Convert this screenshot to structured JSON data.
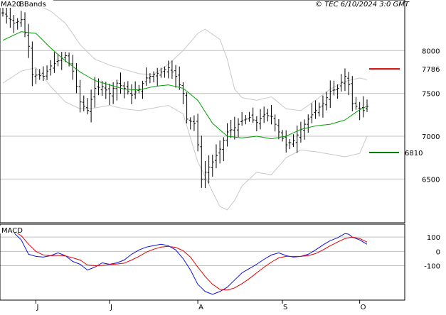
{
  "header": {
    "ma_legend": "MA20",
    "bb_legend": "BBands",
    "copyright": "© TEC 6/10/2024 3:0 GMT"
  },
  "colors": {
    "bars": "#000000",
    "ma": "#00a000",
    "bbands": "#c8c8c8",
    "macd": "#1010e0",
    "signal": "#e00000",
    "resistance": "#d00000",
    "support": "#008000",
    "grid": "#c0c0c0"
  },
  "chart_data": [
    {
      "type": "ohlc",
      "y_ticks": [
        {
          "value": 8000,
          "label": "8000"
        },
        {
          "value": 7500,
          "label": "7500"
        },
        {
          "value": 7000,
          "label": "7000"
        },
        {
          "value": 6500,
          "label": "6500"
        }
      ],
      "ylim": [
        5990,
        8590
      ],
      "x_ticks": [
        {
          "index": 9,
          "label": "J"
        },
        {
          "index": 29,
          "label": "J"
        },
        {
          "index": 53,
          "label": "A"
        },
        {
          "index": 76,
          "label": "S"
        },
        {
          "index": 97,
          "label": "O"
        }
      ],
      "n_points": 100,
      "levels": [
        {
          "name": "resistance",
          "value": 7786,
          "label": "7786"
        },
        {
          "name": "support",
          "value": 6810,
          "label": "6810"
        }
      ],
      "close_anchors": [
        [
          0,
          8440
        ],
        [
          3,
          8320
        ],
        [
          5,
          8360
        ],
        [
          7,
          8050
        ],
        [
          8,
          7720
        ],
        [
          11,
          7700
        ],
        [
          13,
          7820
        ],
        [
          15,
          7880
        ],
        [
          17,
          7940
        ],
        [
          19,
          7760
        ],
        [
          21,
          7400
        ],
        [
          23,
          7300
        ],
        [
          25,
          7560
        ],
        [
          27,
          7580
        ],
        [
          29,
          7500
        ],
        [
          31,
          7620
        ],
        [
          33,
          7560
        ],
        [
          35,
          7480
        ],
        [
          37,
          7550
        ],
        [
          39,
          7680
        ],
        [
          41,
          7720
        ],
        [
          43,
          7750
        ],
        [
          45,
          7800
        ],
        [
          47,
          7700
        ],
        [
          49,
          7500
        ],
        [
          50,
          7200
        ],
        [
          52,
          7150
        ],
        [
          53,
          6900
        ],
        [
          54,
          6500
        ],
        [
          55,
          6580
        ],
        [
          57,
          6700
        ],
        [
          59,
          6850
        ],
        [
          61,
          7050
        ],
        [
          63,
          7100
        ],
        [
          65,
          7180
        ],
        [
          67,
          7220
        ],
        [
          69,
          7160
        ],
        [
          71,
          7250
        ],
        [
          73,
          7230
        ],
        [
          75,
          7050
        ],
        [
          77,
          6900
        ],
        [
          79,
          6950
        ],
        [
          81,
          7080
        ],
        [
          83,
          7200
        ],
        [
          85,
          7300
        ],
        [
          87,
          7380
        ],
        [
          89,
          7520
        ],
        [
          91,
          7560
        ],
        [
          93,
          7700
        ],
        [
          94,
          7600
        ],
        [
          95,
          7380
        ],
        [
          97,
          7320
        ],
        [
          98,
          7300
        ],
        [
          99,
          7350
        ]
      ],
      "ma20_anchors": [
        [
          0,
          8120
        ],
        [
          5,
          8220
        ],
        [
          9,
          8200
        ],
        [
          13,
          8030
        ],
        [
          17,
          7880
        ],
        [
          21,
          7750
        ],
        [
          25,
          7650
        ],
        [
          29,
          7600
        ],
        [
          33,
          7550
        ],
        [
          37,
          7540
        ],
        [
          41,
          7580
        ],
        [
          45,
          7600
        ],
        [
          49,
          7560
        ],
        [
          53,
          7420
        ],
        [
          57,
          7150
        ],
        [
          61,
          7000
        ],
        [
          65,
          6980
        ],
        [
          69,
          7000
        ],
        [
          73,
          6970
        ],
        [
          77,
          7000
        ],
        [
          81,
          7080
        ],
        [
          85,
          7120
        ],
        [
          89,
          7140
        ],
        [
          93,
          7190
        ],
        [
          97,
          7310
        ],
        [
          99,
          7350
        ]
      ],
      "bb_upper_anchors": [
        [
          0,
          8550
        ],
        [
          5,
          8560
        ],
        [
          9,
          8540
        ],
        [
          13,
          8460
        ],
        [
          17,
          8320
        ],
        [
          21,
          8070
        ],
        [
          25,
          7900
        ],
        [
          29,
          7830
        ],
        [
          33,
          7780
        ],
        [
          37,
          7730
        ],
        [
          41,
          7720
        ],
        [
          45,
          7840
        ],
        [
          49,
          8000
        ],
        [
          53,
          8200
        ],
        [
          55,
          8250
        ],
        [
          59,
          8130
        ],
        [
          61,
          7900
        ],
        [
          63,
          7550
        ],
        [
          65,
          7450
        ],
        [
          69,
          7420
        ],
        [
          73,
          7460
        ],
        [
          77,
          7320
        ],
        [
          81,
          7300
        ],
        [
          85,
          7420
        ],
        [
          89,
          7550
        ],
        [
          93,
          7640
        ],
        [
          97,
          7680
        ],
        [
          99,
          7660
        ]
      ],
      "bb_lower_anchors": [
        [
          0,
          7620
        ],
        [
          5,
          7760
        ],
        [
          9,
          7800
        ],
        [
          13,
          7580
        ],
        [
          17,
          7400
        ],
        [
          21,
          7320
        ],
        [
          25,
          7330
        ],
        [
          29,
          7360
        ],
        [
          33,
          7320
        ],
        [
          37,
          7300
        ],
        [
          41,
          7330
        ],
        [
          45,
          7360
        ],
        [
          49,
          7260
        ],
        [
          53,
          6700
        ],
        [
          55,
          6530
        ],
        [
          57,
          6350
        ],
        [
          59,
          6180
        ],
        [
          61,
          6140
        ],
        [
          63,
          6250
        ],
        [
          65,
          6420
        ],
        [
          69,
          6580
        ],
        [
          73,
          6550
        ],
        [
          77,
          6750
        ],
        [
          81,
          6840
        ],
        [
          85,
          6820
        ],
        [
          89,
          6790
        ],
        [
          93,
          6760
        ],
        [
          97,
          6800
        ],
        [
          99,
          7000
        ]
      ]
    },
    {
      "type": "line",
      "legend": "MACD",
      "y_ticks": [
        {
          "value": 100,
          "label": "100"
        },
        {
          "value": 0,
          "label": "0"
        },
        {
          "value": -100,
          "label": "-100"
        }
      ],
      "ylim": [
        -340,
        190
      ],
      "series": [
        {
          "role": "macd",
          "anchors": [
            [
              0,
              140
            ],
            [
              3,
              130
            ],
            [
              5,
              80
            ],
            [
              7,
              -20
            ],
            [
              9,
              -35
            ],
            [
              11,
              -40
            ],
            [
              13,
              -30
            ],
            [
              15,
              -10
            ],
            [
              17,
              -30
            ],
            [
              19,
              -70
            ],
            [
              21,
              -90
            ],
            [
              23,
              -130
            ],
            [
              25,
              -110
            ],
            [
              27,
              -80
            ],
            [
              29,
              -90
            ],
            [
              31,
              -80
            ],
            [
              33,
              -60
            ],
            [
              35,
              -20
            ],
            [
              37,
              10
            ],
            [
              39,
              30
            ],
            [
              41,
              40
            ],
            [
              43,
              50
            ],
            [
              45,
              40
            ],
            [
              47,
              10
            ],
            [
              49,
              -50
            ],
            [
              51,
              -130
            ],
            [
              53,
              -230
            ],
            [
              55,
              -280
            ],
            [
              57,
              -300
            ],
            [
              59,
              -280
            ],
            [
              61,
              -250
            ],
            [
              63,
              -200
            ],
            [
              65,
              -150
            ],
            [
              67,
              -120
            ],
            [
              69,
              -90
            ],
            [
              71,
              -55
            ],
            [
              73,
              -25
            ],
            [
              75,
              -10
            ],
            [
              77,
              -30
            ],
            [
              79,
              -40
            ],
            [
              81,
              -35
            ],
            [
              83,
              -20
            ],
            [
              85,
              10
            ],
            [
              87,
              45
            ],
            [
              89,
              75
            ],
            [
              91,
              95
            ],
            [
              93,
              125
            ],
            [
              94,
              120
            ],
            [
              95,
              100
            ],
            [
              97,
              80
            ],
            [
              99,
              50
            ]
          ]
        },
        {
          "role": "signal",
          "anchors": [
            [
              0,
              145
            ],
            [
              3,
              140
            ],
            [
              5,
              110
            ],
            [
              7,
              50
            ],
            [
              9,
              0
            ],
            [
              11,
              -25
            ],
            [
              13,
              -30
            ],
            [
              15,
              -28
            ],
            [
              17,
              -32
            ],
            [
              19,
              -45
            ],
            [
              21,
              -60
            ],
            [
              23,
              -95
            ],
            [
              25,
              -100
            ],
            [
              27,
              -98
            ],
            [
              29,
              -92
            ],
            [
              31,
              -88
            ],
            [
              33,
              -82
            ],
            [
              35,
              -60
            ],
            [
              37,
              -35
            ],
            [
              39,
              -5
            ],
            [
              41,
              15
            ],
            [
              43,
              30
            ],
            [
              45,
              35
            ],
            [
              47,
              28
            ],
            [
              49,
              5
            ],
            [
              51,
              -40
            ],
            [
              53,
              -110
            ],
            [
              55,
              -175
            ],
            [
              57,
              -230
            ],
            [
              59,
              -265
            ],
            [
              61,
              -270
            ],
            [
              63,
              -255
            ],
            [
              65,
              -225
            ],
            [
              67,
              -190
            ],
            [
              69,
              -150
            ],
            [
              71,
              -110
            ],
            [
              73,
              -75
            ],
            [
              75,
              -45
            ],
            [
              77,
              -35
            ],
            [
              79,
              -35
            ],
            [
              81,
              -35
            ],
            [
              83,
              -30
            ],
            [
              85,
              -15
            ],
            [
              87,
              10
            ],
            [
              89,
              40
            ],
            [
              91,
              65
            ],
            [
              93,
              90
            ],
            [
              95,
              100
            ],
            [
              97,
              90
            ],
            [
              99,
              65
            ]
          ]
        }
      ]
    }
  ]
}
